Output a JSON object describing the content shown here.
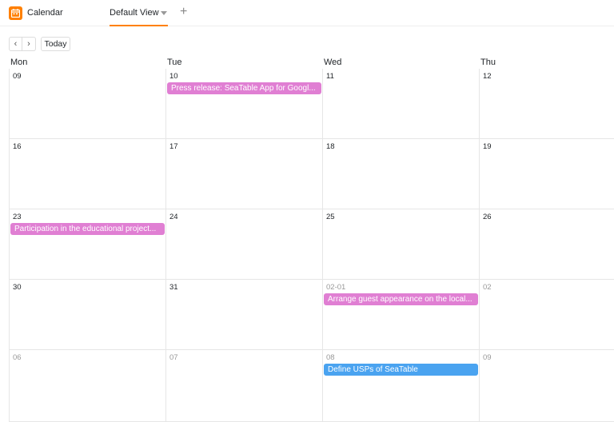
{
  "app": {
    "title": "Calendar",
    "icon": "calendar-icon",
    "accent": "#ff8000"
  },
  "view": {
    "name": "Default View",
    "add_icon": "+"
  },
  "toolbar": {
    "prev_icon": "‹",
    "next_icon": "›",
    "today_label": "Today"
  },
  "weekdays": [
    "Mon",
    "Tue",
    "Wed",
    "Thu"
  ],
  "weeks": [
    {
      "days": [
        {
          "label": "09",
          "muted": false
        },
        {
          "label": "10",
          "muted": false
        },
        {
          "label": "11",
          "muted": false
        },
        {
          "label": "12",
          "muted": false
        }
      ]
    },
    {
      "days": [
        {
          "label": "16",
          "muted": false
        },
        {
          "label": "17",
          "muted": false
        },
        {
          "label": "18",
          "muted": false
        },
        {
          "label": "19",
          "muted": false
        }
      ]
    },
    {
      "days": [
        {
          "label": "23",
          "muted": false
        },
        {
          "label": "24",
          "muted": false
        },
        {
          "label": "25",
          "muted": false
        },
        {
          "label": "26",
          "muted": false
        }
      ]
    },
    {
      "days": [
        {
          "label": "30",
          "muted": false
        },
        {
          "label": "31",
          "muted": false
        },
        {
          "label": "02-01",
          "muted": true
        },
        {
          "label": "02",
          "muted": true
        }
      ]
    },
    {
      "days": [
        {
          "label": "06",
          "muted": true
        },
        {
          "label": "07",
          "muted": true
        },
        {
          "label": "08",
          "muted": true
        },
        {
          "label": "09",
          "muted": true
        }
      ]
    }
  ],
  "events": [
    {
      "title": "Press release: SeaTable App for Googl...",
      "week": 0,
      "day": 1,
      "color": "pink"
    },
    {
      "title": "Participation in the educational project...",
      "week": 2,
      "day": 0,
      "color": "pink"
    },
    {
      "title": "Arrange guest appearance on the local...",
      "week": 3,
      "day": 2,
      "color": "pink"
    },
    {
      "title": "Define USPs of SeaTable",
      "week": 4,
      "day": 2,
      "color": "blue"
    }
  ],
  "colors": {
    "pink": "#e07fd3",
    "blue": "#4aa3f0"
  }
}
